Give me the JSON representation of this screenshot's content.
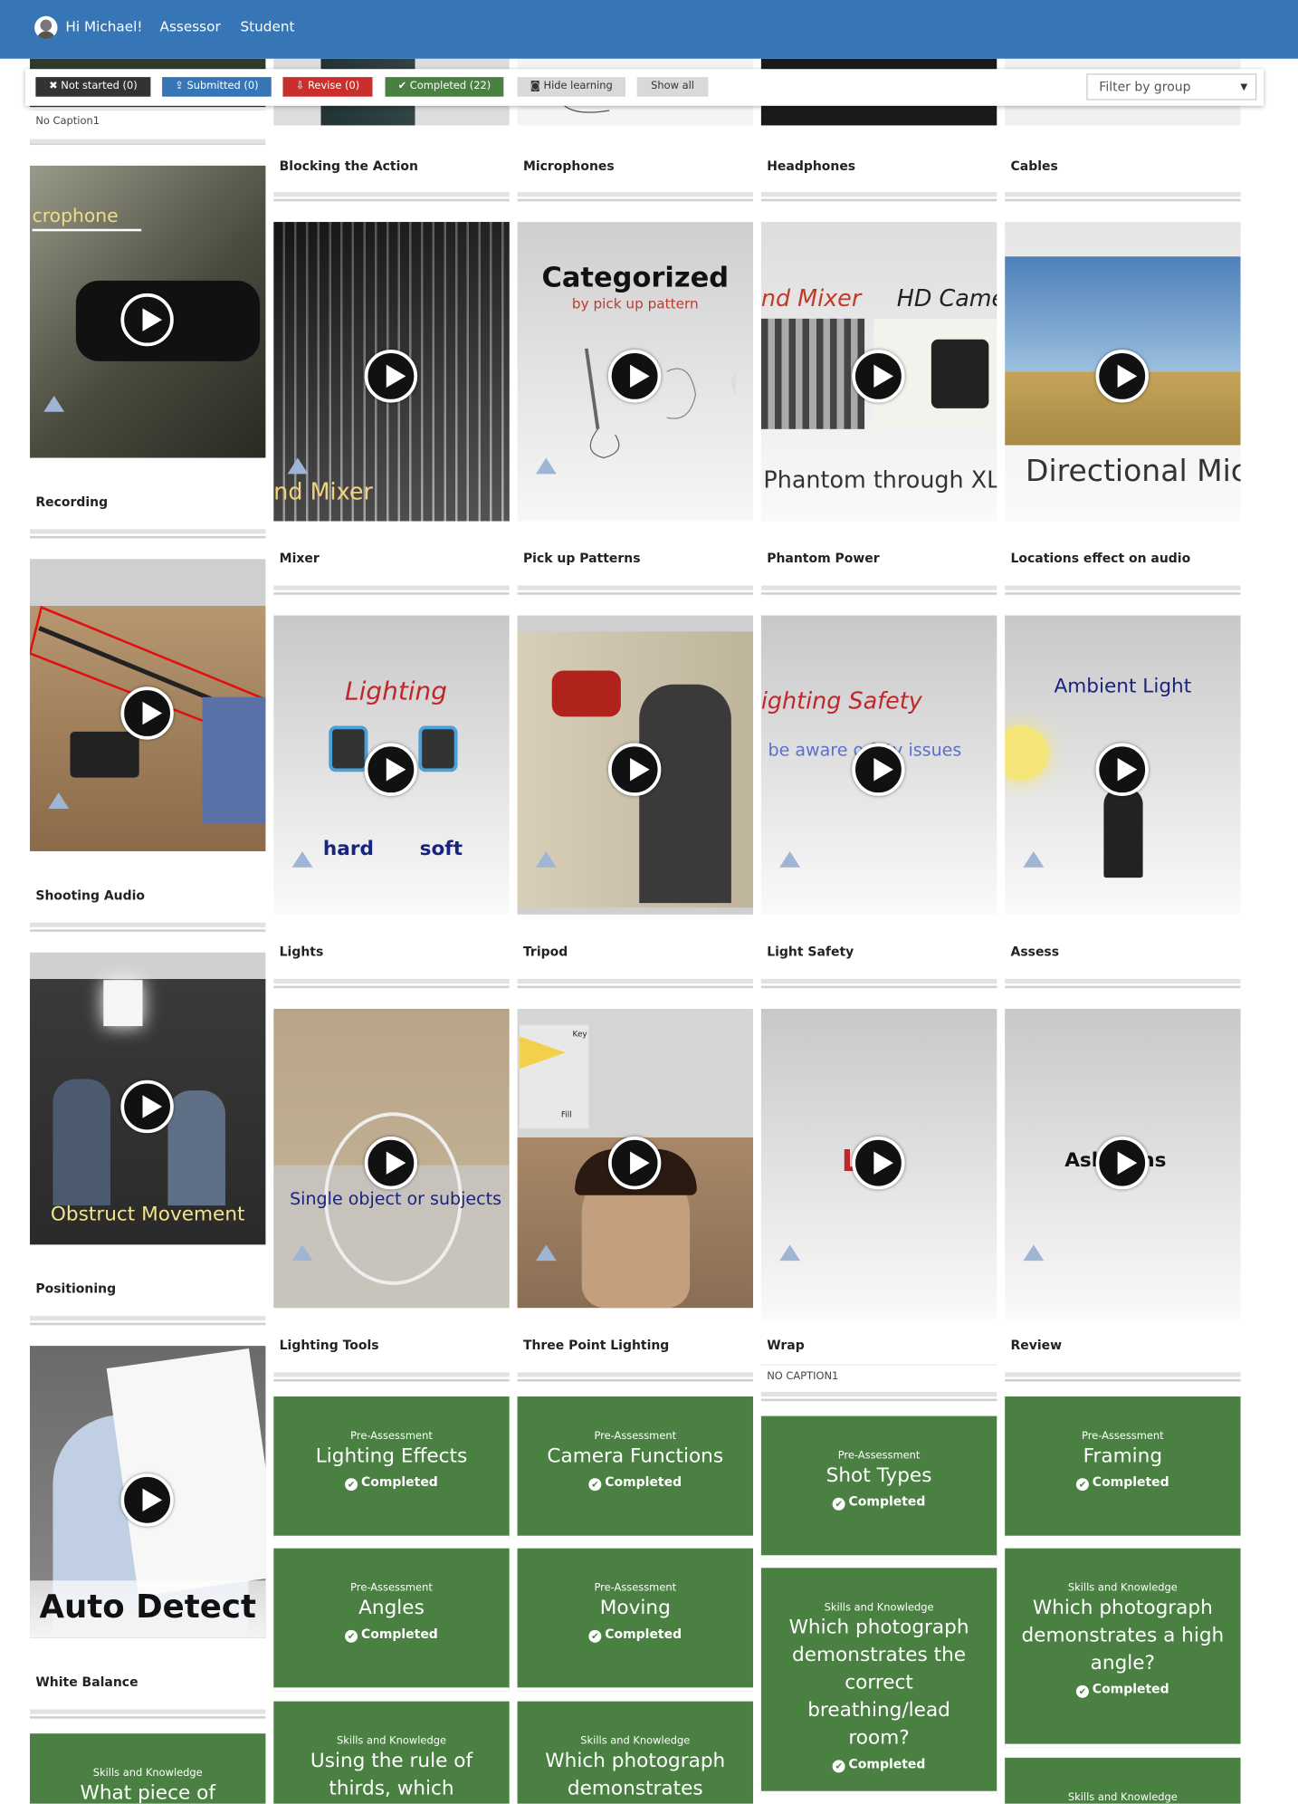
{
  "nav": {
    "greeting": "Hi Michael!",
    "links": [
      "Assessor",
      "Student"
    ]
  },
  "filters": {
    "not_started": "Not started (0)",
    "submitted": "Submitted (0)",
    "revise": "Revise (0)",
    "completed": "Completed (22)",
    "hide_learning": "Hide learning",
    "show_all": "Show all",
    "group_placeholder": "Filter by group",
    "colors": {
      "not_started": "#333333",
      "submitted": "#3676b7",
      "revise": "#c9302c",
      "completed": "#4a8142",
      "neutral": "#d9d9d9"
    }
  },
  "cards": [
    {
      "id": "no-caption-top",
      "caption": "No Caption1"
    },
    {
      "id": "blocking",
      "caption": "Blocking the Action"
    },
    {
      "id": "microphones",
      "caption": "Microphones"
    },
    {
      "id": "headphones",
      "caption": "Headphones"
    },
    {
      "id": "cables",
      "caption": "Cables"
    },
    {
      "id": "recording",
      "caption": "Recording",
      "overlay": "crophone"
    },
    {
      "id": "mixer",
      "caption": "Mixer",
      "overlay": "nd Mixer"
    },
    {
      "id": "pickup",
      "caption": "Pick up Patterns",
      "overlay": "Categorized",
      "overlay2": "by pick up pattern"
    },
    {
      "id": "phantom",
      "caption": "Phantom Power",
      "overlay": "nd Mixer",
      "overlay2": "HD Came",
      "overlay3": "Phantom through XLR"
    },
    {
      "id": "locations",
      "caption": "Locations effect on audio",
      "overlay": "Directional Mic"
    },
    {
      "id": "shooting",
      "caption": "Shooting Audio"
    },
    {
      "id": "lights",
      "caption": "Lights",
      "overlay": "Lighting",
      "overlay2": "hard",
      "overlay3": "soft"
    },
    {
      "id": "tripod",
      "caption": "Tripod"
    },
    {
      "id": "lightsafety",
      "caption": "Light Safety",
      "overlay": "ighting Safety",
      "overlay2": "be aware o  fety issues"
    },
    {
      "id": "assess",
      "caption": "Assess",
      "overlay": "Ambient Light"
    },
    {
      "id": "positioning",
      "caption": "Positioning",
      "overlay": "Obstruct Movement"
    },
    {
      "id": "lightingtools",
      "caption": "Lighting Tools",
      "overlay": "Single object or subjects"
    },
    {
      "id": "threepoint",
      "caption": "Three Point Lighting",
      "overlay": "Key",
      "overlay2": "Fill"
    },
    {
      "id": "wrap",
      "caption": "Wrap",
      "overlay": "L  I",
      "sub": "NO CAPTION1"
    },
    {
      "id": "review",
      "caption": "Review",
      "overlay": "Ask    tions"
    },
    {
      "id": "whitebalance",
      "caption": "White Balance",
      "overlay": "Auto Detect"
    }
  ],
  "tasks": [
    {
      "type": "Pre-Assessment",
      "title": "Lighting Effects",
      "status": "Completed"
    },
    {
      "type": "Pre-Assessment",
      "title": "Camera Functions",
      "status": "Completed"
    },
    {
      "type": "Pre-Assessment",
      "title": "Shot Types",
      "status": "Completed"
    },
    {
      "type": "Pre-Assessment",
      "title": "Framing",
      "status": "Completed"
    },
    {
      "type": "Pre-Assessment",
      "title": "Angles",
      "status": "Completed"
    },
    {
      "type": "Pre-Assessment",
      "title": "Moving",
      "status": "Completed"
    },
    {
      "type": "Skills and Knowledge",
      "title": "Which photograph demonstrates the correct breathing/lead room?",
      "status": "Completed"
    },
    {
      "type": "Skills and Knowledge",
      "title": "Which photograph demonstrates a high angle?",
      "status": "Completed"
    },
    {
      "type": "Skills and Knowledge",
      "title": "Using the rule of thirds, which",
      "status": ""
    },
    {
      "type": "Skills and Knowledge",
      "title": "Which photograph demonstrates",
      "status": ""
    },
    {
      "type": "Skills and Knowledge",
      "title": "What piece of",
      "status": ""
    },
    {
      "type": "Skills and Knowledge",
      "title": "",
      "status": ""
    }
  ]
}
